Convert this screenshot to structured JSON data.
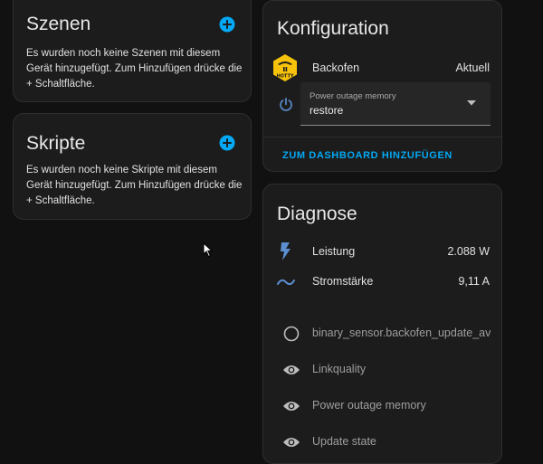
{
  "colors": {
    "background": "#111111",
    "card": "#1c1c1c",
    "accent": "#03a9f4",
    "icon_blue": "#5b8fcf",
    "icon_grey": "#bdbdbd"
  },
  "scenes": {
    "title": "Szenen",
    "empty_text": "Es wurden noch keine Szenen mit diesem Gerät hinzugefügt. Zum Hinzufügen drücke die + Schaltfläche.",
    "add_icon": "plus-circle-icon"
  },
  "scripts": {
    "title": "Skripte",
    "empty_text": "Es wurden noch keine Skripte mit diesem Gerät hinzugefügt. Zum Hinzufügen drücke die + Schaltfläche.",
    "add_icon": "plus-circle-icon"
  },
  "config": {
    "title": "Konfiguration",
    "device_row": {
      "icon": "hotty-logo-icon",
      "logo_text": "HOTTY",
      "name": "Backofen",
      "status": "Aktuell"
    },
    "select": {
      "icon": "power-icon",
      "label": "Power outage memory",
      "value": "restore",
      "dropdown_icon": "caret-down-icon"
    },
    "dashboard_button": "ZUM DASHBOARD HINZUFÜGEN"
  },
  "diagnose": {
    "title": "Diagnose",
    "sensors": [
      {
        "icon": "flash-icon",
        "label": "Leistung",
        "value": "2.088 W"
      },
      {
        "icon": "current-ac-icon",
        "label": "Stromstärke",
        "value": "9,11 A"
      }
    ],
    "hidden_entities": [
      {
        "icon": "circle-outline-icon",
        "label": "binary_sensor.backofen_update_avai"
      },
      {
        "icon": "eye-icon",
        "label": "Linkquality"
      },
      {
        "icon": "eye-icon",
        "label": "Power outage memory"
      },
      {
        "icon": "eye-icon",
        "label": "Update state"
      }
    ]
  }
}
